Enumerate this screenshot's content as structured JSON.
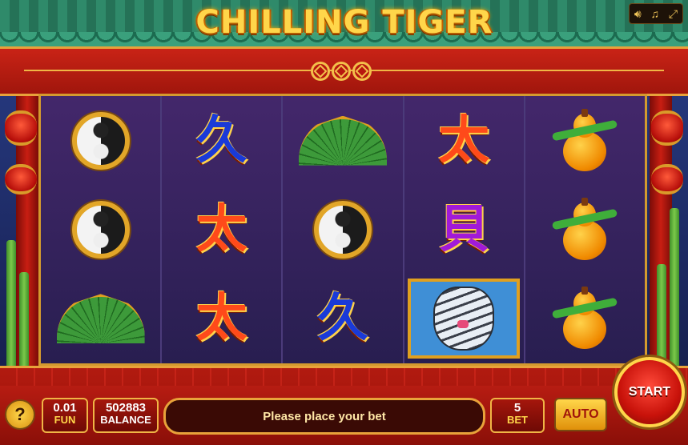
{
  "game": {
    "title": "CHILLING TIGER"
  },
  "top_icons": [
    "speaker-icon",
    "music-icon",
    "fullscreen-icon"
  ],
  "reels": [
    [
      "yin-yang",
      "yin-yang",
      "fan"
    ],
    [
      "kanji-blue",
      "kanji-red",
      "kanji-red"
    ],
    [
      "fan",
      "yin-yang",
      "kanji-blue"
    ],
    [
      "kanji-red",
      "kanji-purple",
      "tiger-wild"
    ],
    [
      "gourd",
      "gourd",
      "gourd"
    ]
  ],
  "controls": {
    "help_label": "?",
    "coin_value": "0.01",
    "coin_label": "FUN",
    "balance_value": "502883",
    "balance_label": "BALANCE",
    "message": "Please place your bet",
    "bet_value": "5",
    "bet_label": "BET",
    "auto_label": "AUTO",
    "start_label": "START"
  },
  "colors": {
    "accent_gold": "#f0b545",
    "frame_red": "#c42015",
    "roof_green": "#2f8a6a"
  }
}
